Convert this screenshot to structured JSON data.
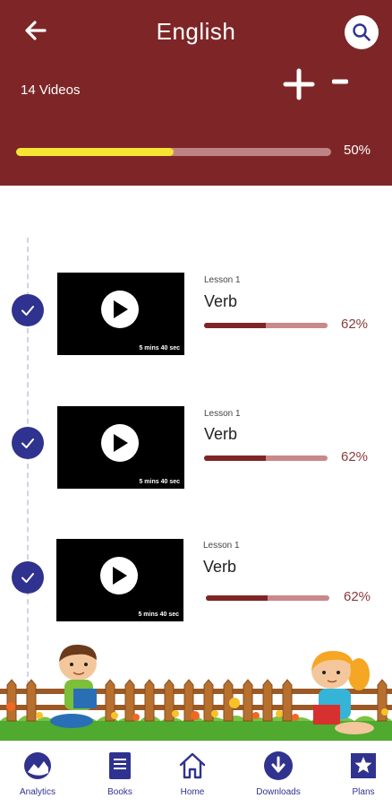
{
  "header": {
    "title": "English",
    "video_count": "14 Videos",
    "progress_fraction": 0.5,
    "progress_label": "50%"
  },
  "lessons": [
    {
      "lesson_no": "Lesson 1",
      "title": "Verb",
      "duration": "5 mins 40 sec",
      "progress_fraction": 0.5,
      "progress_label": "62%",
      "completed": true
    },
    {
      "lesson_no": "Lesson 1",
      "title": "Verb",
      "duration": "5 mins 40 sec",
      "progress_fraction": 0.5,
      "progress_label": "62%",
      "completed": true
    },
    {
      "lesson_no": "Lesson 1",
      "title": "Verb",
      "duration": "5 mins 40 sec",
      "progress_fraction": 0.5,
      "progress_label": "62%",
      "completed": true
    }
  ],
  "nav": {
    "items": [
      {
        "label": "Analytics",
        "icon": "analytics-icon"
      },
      {
        "label": "Books",
        "icon": "books-icon"
      },
      {
        "label": "Home",
        "icon": "home-icon"
      },
      {
        "label": "Downloads",
        "icon": "downloads-icon"
      },
      {
        "label": "Plans",
        "icon": "plans-icon"
      }
    ]
  },
  "colors": {
    "header_bg": "#7e2627",
    "progress_fill": "#f6e532",
    "accent_blue": "#30328f"
  }
}
